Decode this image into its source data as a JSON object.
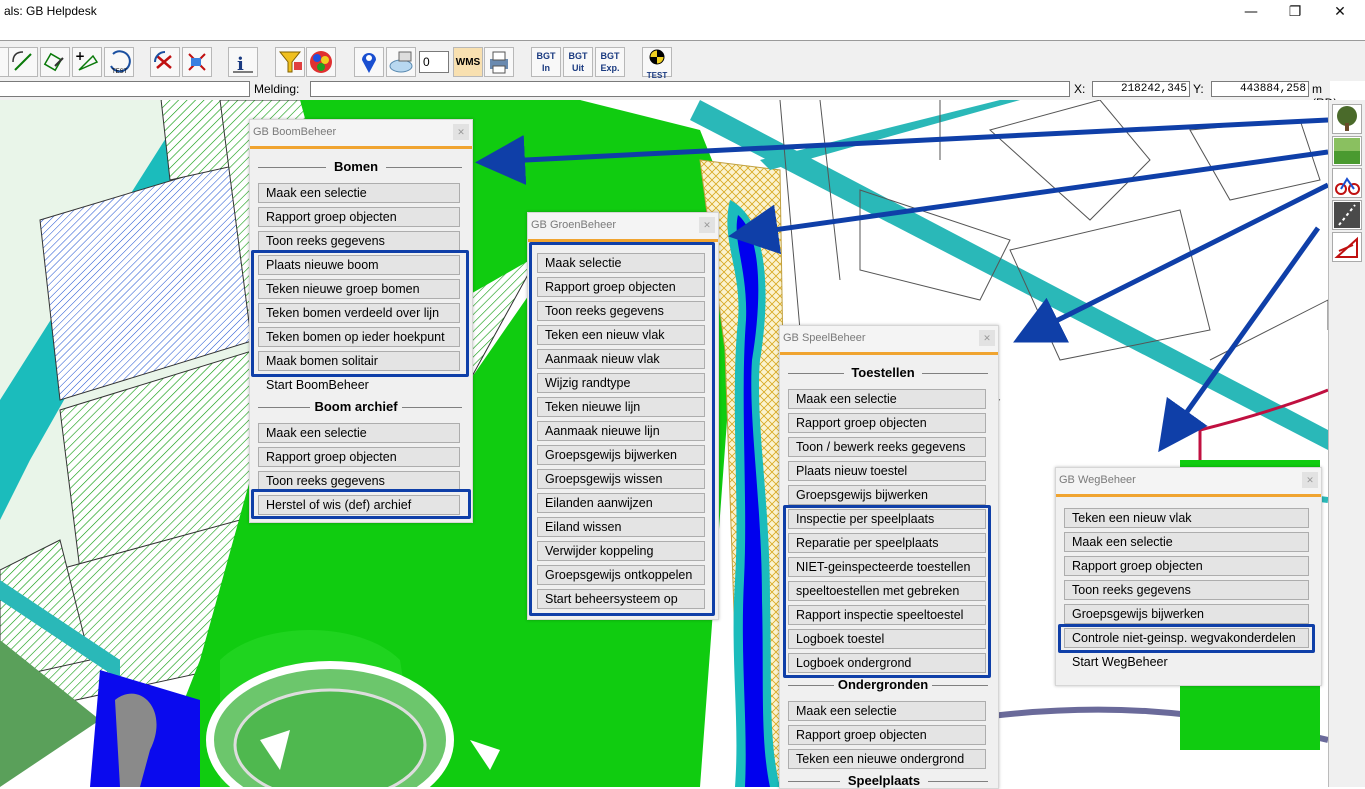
{
  "window": {
    "title": "als: GB Helpdesk",
    "minimize": "—",
    "maximize": "❐",
    "close": "✕"
  },
  "toolbar": {
    "counter_value": "0",
    "wms_label": "WMS",
    "bgt_in": "BGT In",
    "bgt_uit": "BGT Uit",
    "bgt_exp": "BGT Exp.",
    "test_label": "TEST",
    "test_small": "TEST"
  },
  "statusbar": {
    "melding_label": "Melding:",
    "melding_value": "",
    "x_label": "X:",
    "x_value": "218242,345",
    "y_label": "Y:",
    "y_value": "443884,258",
    "unit": "m (RD)"
  },
  "panels": {
    "boom": {
      "title": "GB BoomBeheer",
      "section1": "Bomen",
      "buttons1": [
        "Maak een selectie",
        "Rapport groep objecten",
        "Toon reeks gegevens",
        "Plaats nieuwe boom",
        "Teken nieuwe groep bomen",
        "Teken bomen verdeeld over lijn",
        "Teken bomen op ieder hoekpunt",
        "Maak bomen solitair"
      ],
      "start": "Start BoomBeheer",
      "section2": "Boom archief",
      "buttons2": [
        "Maak een selectie",
        "Rapport groep objecten",
        "Toon reeks gegevens",
        "Herstel of wis (def) archief"
      ]
    },
    "groen": {
      "title": "GB GroenBeheer",
      "buttons": [
        "Maak selectie",
        "Rapport groep objecten",
        "Toon reeks gegevens",
        "Teken een nieuw vlak",
        "Aanmaak nieuw vlak",
        "Wijzig randtype",
        "Teken nieuwe lijn",
        "Aanmaak nieuwe lijn",
        "Groepsgewijs bijwerken",
        "Groepsgewijs wissen",
        "Eilanden aanwijzen",
        "Eiland wissen",
        "Verwijder koppeling",
        "Groepsgewijs ontkoppelen",
        "Start beheersysteem op"
      ]
    },
    "speel": {
      "title": "GB SpeelBeheer",
      "section1": "Toestellen",
      "buttons1": [
        "Maak een selectie",
        "Rapport groep objecten",
        "Toon / bewerk reeks gegevens",
        "Plaats nieuw toestel",
        "Groepsgewijs bijwerken",
        "Inspectie per speelplaats",
        "Reparatie per speelplaats",
        "NIET-geinspecteerde toestellen",
        "speeltoestellen met gebreken",
        "Rapport inspectie speeltoestel",
        "Logboek toestel",
        "Logboek ondergrond"
      ],
      "section2": "Ondergronden",
      "buttons2": [
        "Maak een selectie",
        "Rapport groep objecten",
        "Teken een nieuwe ondergrond"
      ],
      "section3": "Speelplaats"
    },
    "weg": {
      "title": "GB WegBeheer",
      "buttons": [
        "Teken een nieuw vlak",
        "Maak een selectie",
        "Rapport groep objecten",
        "Toon reeks gegevens",
        "Groepsgewijs bijwerken",
        "Controle niet-geinsp. wegvakonderdelen",
        "Start WegBeheer"
      ]
    }
  },
  "colors": {
    "highlight": "#0f3fa8",
    "arrow": "#0f3fa8",
    "panel_accent": "#f0a430",
    "grass": "#10cc10",
    "water": "#0000ee",
    "road": "#2ab8b8"
  },
  "right_icons": [
    "tree-icon",
    "grass-icon",
    "playground-icon",
    "road-icon",
    "warning-icon"
  ]
}
